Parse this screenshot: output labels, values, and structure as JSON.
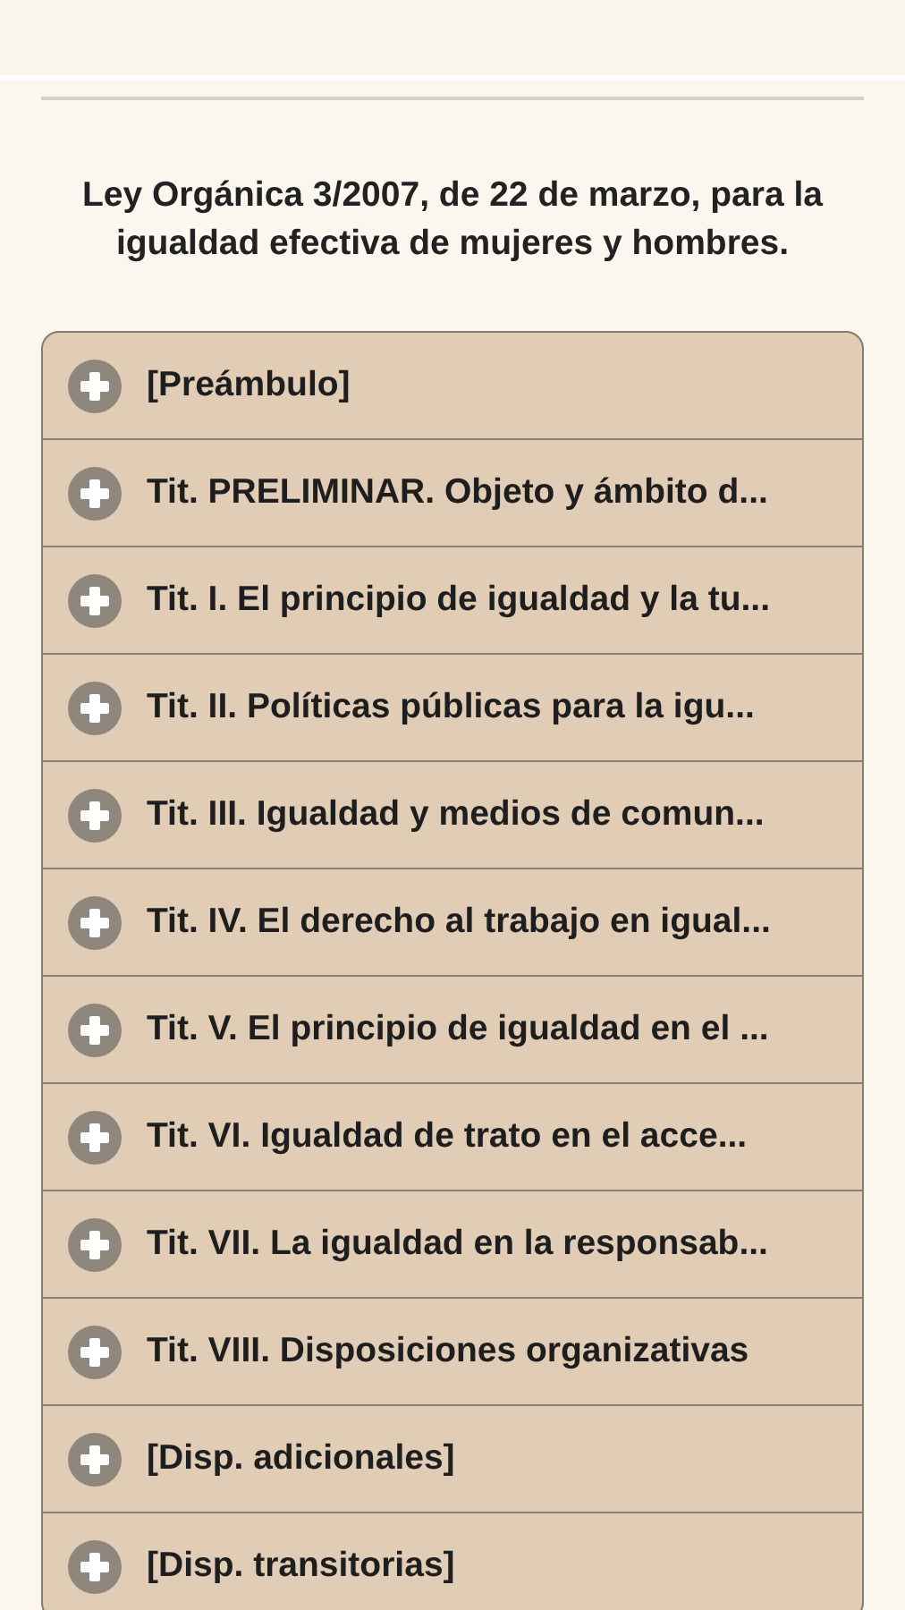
{
  "title": "Ley Orgánica 3/2007, de 22 de marzo, para la igualdad efectiva de mujeres y hombres.",
  "sections": [
    {
      "label": "[Preámbulo]",
      "expanded": false
    },
    {
      "label": "Tit. PRELIMINAR. Objeto y ámbito d...",
      "expanded": false
    },
    {
      "label": "Tit. I. El principio de igualdad y la tu...",
      "expanded": false
    },
    {
      "label": "Tit. II. Políticas públicas para la igu...",
      "expanded": false
    },
    {
      "label": "Tit. III. Igualdad y medios de comun...",
      "expanded": false
    },
    {
      "label": "Tit. IV. El derecho al trabajo en igual...",
      "expanded": false
    },
    {
      "label": "Tit. V. El principio de igualdad en el ...",
      "expanded": false
    },
    {
      "label": "Tit. VI. Igualdad de trato en el acce...",
      "expanded": false
    },
    {
      "label": "Tit. VII. La igualdad en la responsab...",
      "expanded": false
    },
    {
      "label": "Tit. VIII. Disposiciones organizativas",
      "expanded": false
    },
    {
      "label": "[Disp. adicionales]",
      "expanded": false
    },
    {
      "label": "[Disp. transitorias]",
      "expanded": false
    }
  ]
}
